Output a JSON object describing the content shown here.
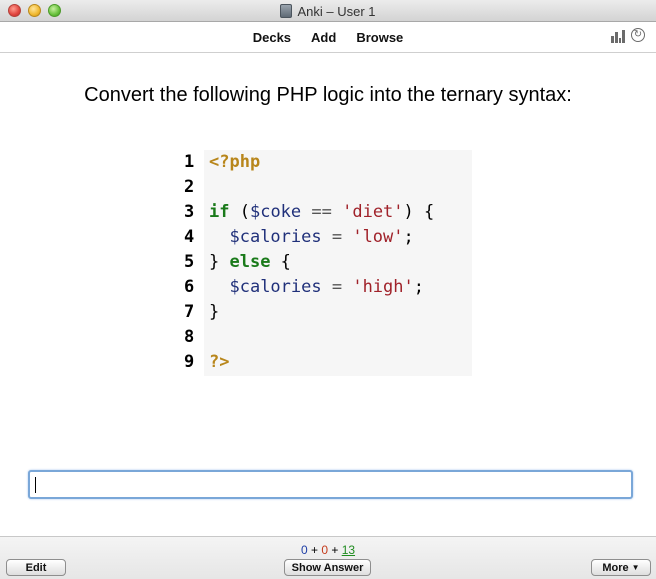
{
  "window": {
    "title": "Anki – User 1"
  },
  "toolbar": {
    "links": [
      "Decks",
      "Add",
      "Browse"
    ],
    "icons": [
      "stats-icon",
      "sync-icon"
    ]
  },
  "card": {
    "question": "Convert the following PHP logic into the ternary syntax:",
    "code_lines": [
      {
        "num": "1",
        "tokens": [
          {
            "t": "<?php",
            "c": "php"
          }
        ]
      },
      {
        "num": "2",
        "tokens": []
      },
      {
        "num": "3",
        "tokens": [
          {
            "t": "if",
            "c": "kw"
          },
          {
            "t": " (",
            "c": "pun"
          },
          {
            "t": "$coke",
            "c": "var"
          },
          {
            "t": " == ",
            "c": "op"
          },
          {
            "t": "'diet'",
            "c": "str"
          },
          {
            "t": ") {",
            "c": "pun"
          }
        ]
      },
      {
        "num": "4",
        "tokens": [
          {
            "t": "  ",
            "c": "pun"
          },
          {
            "t": "$calories",
            "c": "var"
          },
          {
            "t": " = ",
            "c": "op"
          },
          {
            "t": "'low'",
            "c": "str"
          },
          {
            "t": ";",
            "c": "pun"
          }
        ]
      },
      {
        "num": "5",
        "tokens": [
          {
            "t": "} ",
            "c": "pun"
          },
          {
            "t": "else",
            "c": "kw"
          },
          {
            "t": " {",
            "c": "pun"
          }
        ]
      },
      {
        "num": "6",
        "tokens": [
          {
            "t": "  ",
            "c": "pun"
          },
          {
            "t": "$calories",
            "c": "var"
          },
          {
            "t": " = ",
            "c": "op"
          },
          {
            "t": "'high'",
            "c": "str"
          },
          {
            "t": ";",
            "c": "pun"
          }
        ]
      },
      {
        "num": "7",
        "tokens": [
          {
            "t": "}",
            "c": "pun"
          }
        ]
      },
      {
        "num": "8",
        "tokens": []
      },
      {
        "num": "9",
        "tokens": [
          {
            "t": "?>",
            "c": "php"
          }
        ]
      }
    ],
    "answer_value": ""
  },
  "bottom": {
    "counts": {
      "new": "0",
      "sep1": " + ",
      "learning": "0",
      "sep2": " + ",
      "review": "13"
    },
    "edit_label": "Edit",
    "show_answer_label": "Show Answer",
    "more_label": "More"
  },
  "colors": {
    "php_tag": "#b8861b",
    "keyword": "#1a7a1a",
    "variable": "#20307a",
    "string": "#a0222a",
    "count_new": "#1f3fa6",
    "count_learning": "#c43b1c",
    "count_review": "#1f8b1f"
  }
}
